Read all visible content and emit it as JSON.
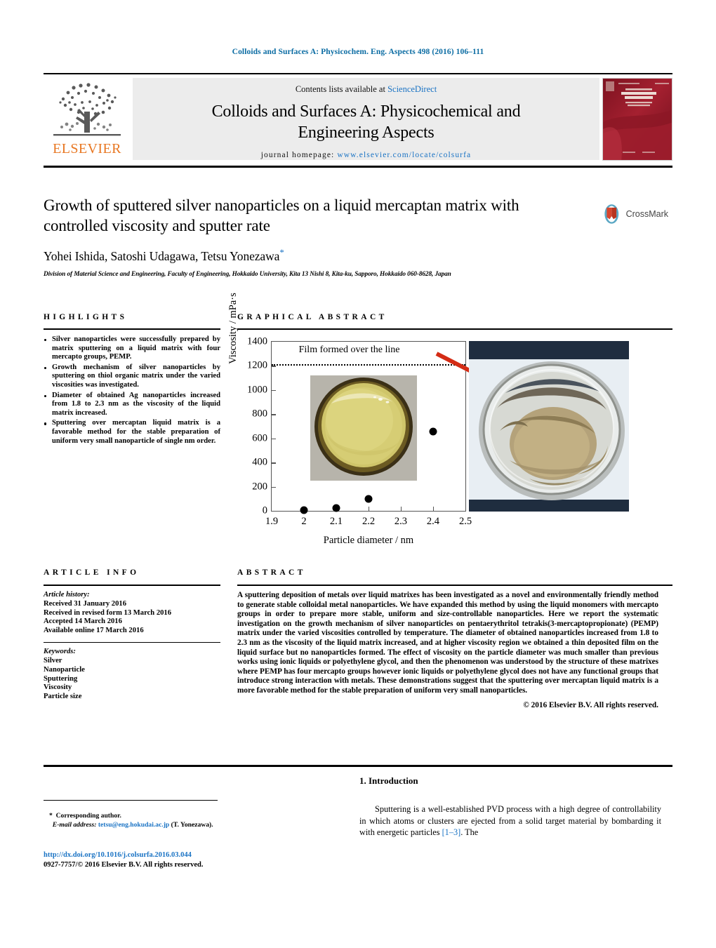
{
  "running_head": "Colloids and Surfaces A: Physicochem. Eng. Aspects 498 (2016) 106–111",
  "masthead": {
    "contents_prefix": "Contents lists available at ",
    "sciencedirect": "ScienceDirect",
    "journal_title_line1": "Colloids and Surfaces A: Physicochemical and",
    "journal_title_line2": "Engineering Aspects",
    "homepage_prefix": "journal homepage: ",
    "homepage_url": "www.elsevier.com/locate/colsurfa",
    "publisher": "ELSEVIER",
    "cover_alt": "journal-cover-thumbnail"
  },
  "article": {
    "title": "Growth of sputtered silver nanoparticles on a liquid mercaptan matrix with controlled viscosity and sputter rate",
    "authors": "Yohei Ishida, Satoshi Udagawa, Tetsu Yonezawa",
    "author_star": "*",
    "affiliation": "Division of Material Science and Engineering, Faculty of Engineering, Hokkaido University, Kita 13 Nishi 8, Kita-ku, Sapporo, Hokkaido 060-8628, Japan",
    "crossmark_label": "CrossMark"
  },
  "highlights": {
    "heading": "HIGHLIGHTS",
    "items": [
      "Silver nanoparticles were successfully prepared by matrix sputtering on a liquid matrix with four mercapto groups, PEMP.",
      "Growth mechanism of silver nanoparticles by sputtering on thiol organic matrix under the varied viscosities was investigated.",
      "Diameter of obtained Ag nanoparticles increased from 1.8 to 2.3 nm as the viscosity of the liquid matrix increased.",
      "Sputtering over mercaptan liquid matrix is a favorable method for the stable preparation of uniform very small nanoparticle of single nm order."
    ]
  },
  "graphical_abstract": {
    "heading": "GRAPHICAL ABSTRACT"
  },
  "chart_data": {
    "type": "scatter",
    "title": "",
    "xlabel": "Particle diameter / nm",
    "ylabel": "Viscosity / mPa·s",
    "xlim": [
      1.9,
      2.5
    ],
    "ylim": [
      0,
      1400
    ],
    "xticks": [
      "1.9",
      "2",
      "2.1",
      "2.2",
      "2.3",
      "2.4",
      "2.5"
    ],
    "xtick_values": [
      1.9,
      2.0,
      2.1,
      2.2,
      2.3,
      2.4,
      2.5
    ],
    "yticks": [
      "0",
      "200",
      "400",
      "600",
      "800",
      "1000",
      "1200",
      "1400"
    ],
    "ytick_values": [
      0,
      200,
      400,
      600,
      800,
      1000,
      1200,
      1400
    ],
    "grid": false,
    "legend": "none",
    "points": [
      {
        "x": 2.0,
        "y": 5
      },
      {
        "x": 2.1,
        "y": 25
      },
      {
        "x": 2.2,
        "y": 100
      },
      {
        "x": 2.4,
        "y": 655
      }
    ],
    "annotations": [
      {
        "text": "Film formed over the line",
        "x": 2.12,
        "y": 1330
      },
      {
        "text": "threshold-line",
        "type": "dotted-hline",
        "y": 1215
      }
    ],
    "inset_images": [
      "beaker-liquid-photo",
      "beaker-film-photo"
    ]
  },
  "article_info": {
    "heading": "ARTICLE INFO",
    "history_label": "Article history:",
    "history": [
      "Received 31 January 2016",
      "Received in revised form 13 March 2016",
      "Accepted 14 March 2016",
      "Available online 17 March 2016"
    ],
    "keywords_label": "Keywords:",
    "keywords": [
      "Silver",
      "Nanoparticle",
      "Sputtering",
      "Viscosity",
      "Particle size"
    ]
  },
  "abstract": {
    "heading": "ABSTRACT",
    "text": "A sputtering deposition of metals over liquid matrixes has been investigated as a novel and environmentally friendly method to generate stable colloidal metal nanoparticles. We have expanded this method by using the liquid monomers with mercapto groups in order to prepare more stable, uniform and size-controllable nanoparticles. Here we report the systematic investigation on the growth mechanism of silver nanoparticles on pentaerythritol tetrakis(3-mercaptopropionate) (PEMP) matrix under the varied viscosities controlled by temperature. The diameter of obtained nanoparticles increased from 1.8 to 2.3 nm as the viscosity of the liquid matrix increased, and at higher viscosity region we obtained a thin deposited film on the liquid surface but no nanoparticles formed. The effect of viscosity on the particle diameter was much smaller than previous works using ionic liquids or polyethylene glycol, and then the phenomenon was understood by the structure of these matrixes where PEMP has four mercapto groups however ionic liquids or polyethylene glycol does not have any functional groups that introduce strong interaction with metals. These demonstrations suggest that the sputtering over mercaptan liquid matrix is a more favorable method for the stable preparation of uniform very small nanoparticles.",
    "copyright": "© 2016 Elsevier B.V. All rights reserved."
  },
  "introduction": {
    "heading": "1. Introduction",
    "paragraph_part1": "Sputtering is a well-established PVD process with a high degree of controllability in which atoms or clusters are ejected from a solid target material by bombarding it with energetic particles ",
    "reference": "[1–3]",
    "paragraph_part2": ". The"
  },
  "footer": {
    "corr_star": "*",
    "corr_label": "Corresponding author.",
    "email_label": "E-mail address:",
    "email": "tetsu@eng.hokudai.ac.jp",
    "email_suffix": "(T. Yonezawa).",
    "doi": "http://dx.doi.org/10.1016/j.colsurfa.2016.03.044",
    "issn_line": "0927-7757/© 2016 Elsevier B.V. All rights reserved."
  },
  "colors": {
    "link": "#1a73c4",
    "runhead": "#0b6ca3",
    "elsevier_orange": "#E87722",
    "arrow_red": "#d42c15",
    "cover_red": "#9e1b28"
  }
}
